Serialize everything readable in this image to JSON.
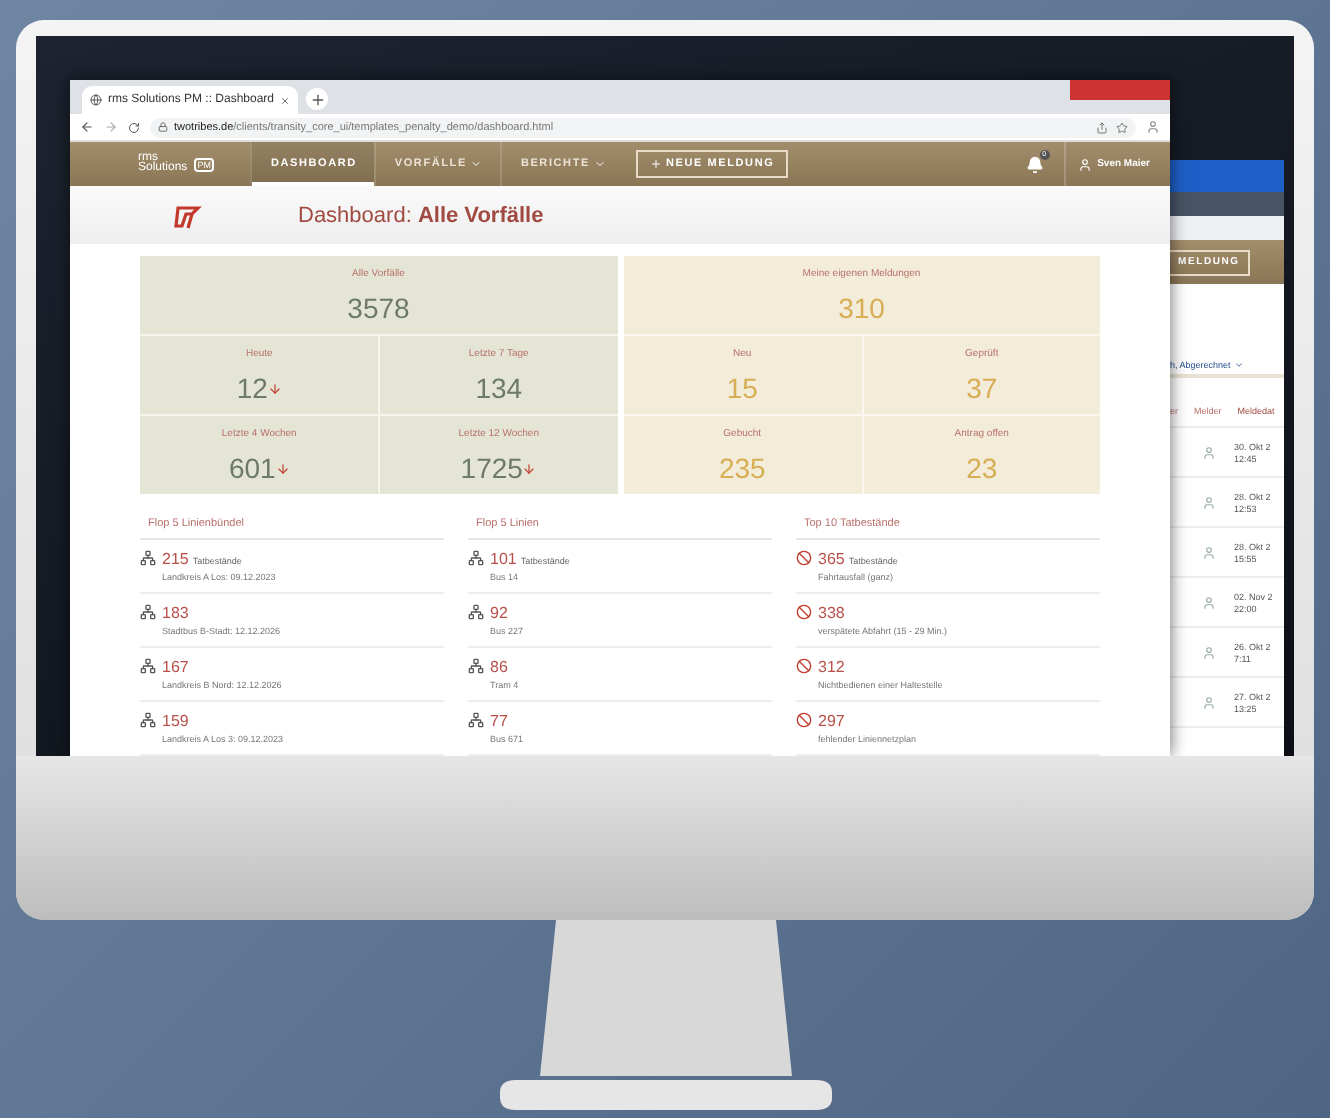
{
  "browser": {
    "tab_title": "rms Solutions PM :: Dashboard",
    "url_domain": "twotribes.de",
    "url_path": "/clients/transity_core_ui/templates_penalty_demo/dashboard.html"
  },
  "app_bar": {
    "logo_top": "rms",
    "logo_bottom": "Solutions",
    "logo_badge": "PM",
    "nav": [
      {
        "label": "DASHBOARD",
        "selected": true,
        "dropdown": false
      },
      {
        "label": "VORFÄLLE",
        "selected": false,
        "dropdown": true
      },
      {
        "label": "BERICHTE",
        "selected": false,
        "dropdown": true
      }
    ],
    "new_button": "NEUE MELDUNG",
    "notification_count": "0",
    "user": "Sven Maier"
  },
  "page_title": {
    "prefix": "Dashboard:",
    "emphasis": "Alle Vorfälle"
  },
  "stats": [
    {
      "kind": "all",
      "title": "Alle Vorfälle",
      "total": "3578",
      "cells": [
        {
          "label": "Heute",
          "value": "12",
          "falling": true
        },
        {
          "label": "Letzte 7 Tage",
          "value": "134",
          "falling": false
        },
        {
          "label": "Letzte 4 Wochen",
          "value": "601",
          "falling": true
        },
        {
          "label": "Letzte 12 Wochen",
          "value": "1725",
          "falling": true
        }
      ]
    },
    {
      "kind": "own",
      "title": "Meine eigenen Meldungen",
      "total": "310",
      "cells": [
        {
          "label": "Neu",
          "value": "15",
          "falling": false
        },
        {
          "label": "Geprüft",
          "value": "37",
          "falling": false
        },
        {
          "label": "Gebucht",
          "value": "235",
          "falling": false
        },
        {
          "label": "Antrag offen",
          "value": "23",
          "falling": false
        }
      ]
    }
  ],
  "lists": [
    {
      "kind": "network",
      "title": "Flop 5 Linienbündel",
      "items": [
        {
          "count": "215",
          "unit": "Tatbestände",
          "subtitle": "Landkreis A Los: 09.12.2023"
        },
        {
          "count": "183",
          "subtitle": "Stadtbus B-Stadt: 12.12.2026"
        },
        {
          "count": "167",
          "subtitle": "Landkreis B Nord: 12.12.2026"
        },
        {
          "count": "159",
          "subtitle": "Landkreis A Los 3: 09.12.2023"
        }
      ]
    },
    {
      "kind": "network",
      "title": "Flop 5 Linien",
      "items": [
        {
          "count": "101",
          "unit": "Tatbestände",
          "subtitle": "Bus 14"
        },
        {
          "count": "92",
          "subtitle": "Bus 227"
        },
        {
          "count": "86",
          "subtitle": "Tram 4"
        },
        {
          "count": "77",
          "subtitle": "Bus 671"
        }
      ]
    },
    {
      "kind": "offense",
      "title": "Top 10 Tatbestände",
      "items": [
        {
          "count": "365",
          "unit": "Tatbestände",
          "subtitle": "Fahrtausfall (ganz)"
        },
        {
          "count": "338",
          "subtitle": "verspätete Abfahrt (15 - 29 Min.)"
        },
        {
          "count": "312",
          "subtitle": "Nichtbedienen einer Haltestelle"
        },
        {
          "count": "297",
          "subtitle": "fehlender Liniennetzplan"
        }
      ]
    }
  ],
  "back_window": {
    "button": "MELDUNG",
    "filter": "h, Abgerechnet",
    "columns": [
      "er",
      "Melder",
      "Meldedat"
    ],
    "rows": [
      {
        "date": "30. Okt 2",
        "time": "12:45"
      },
      {
        "date": "28. Okt 2",
        "time": "12:53"
      },
      {
        "date": "28. Okt 2",
        "time": "15:55"
      },
      {
        "date": "02. Nov 2",
        "time": "22:00"
      },
      {
        "date": "26. Okt 2",
        "time": "7:11"
      },
      {
        "date": "27. Okt 2",
        "time": "13:25"
      }
    ]
  }
}
